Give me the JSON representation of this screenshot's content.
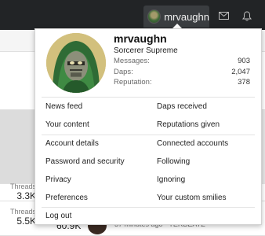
{
  "navbar": {
    "username": "mrvaughn",
    "inbox_icon": "envelope-icon",
    "alerts_icon": "bell-icon"
  },
  "background": {
    "row1": {
      "label": "Threads",
      "value": "3.3K"
    },
    "row2": {
      "label": "Threads",
      "value": "5.5K",
      "messages_value": "60.9K",
      "meta_text": "37 minutes ago · TERBEATZ"
    }
  },
  "profile": {
    "name": "mrvaughn",
    "title": "Sorcerer Supreme",
    "stats": [
      {
        "label": "Messages:",
        "value": "903"
      },
      {
        "label": "Daps:",
        "value": "2,047"
      },
      {
        "label": "Reputation:",
        "value": "378"
      }
    ]
  },
  "menu": {
    "group1": [
      {
        "left": "News feed",
        "right": "Daps received"
      },
      {
        "left": "Your content",
        "right": "Reputations given"
      }
    ],
    "group2": [
      {
        "left": "Account details",
        "right": "Connected accounts"
      },
      {
        "left": "Password and security",
        "right": "Following"
      },
      {
        "left": "Privacy",
        "right": "Ignoring"
      },
      {
        "left": "Preferences",
        "right": "Your custom smilies"
      }
    ],
    "logout": "Log out"
  }
}
